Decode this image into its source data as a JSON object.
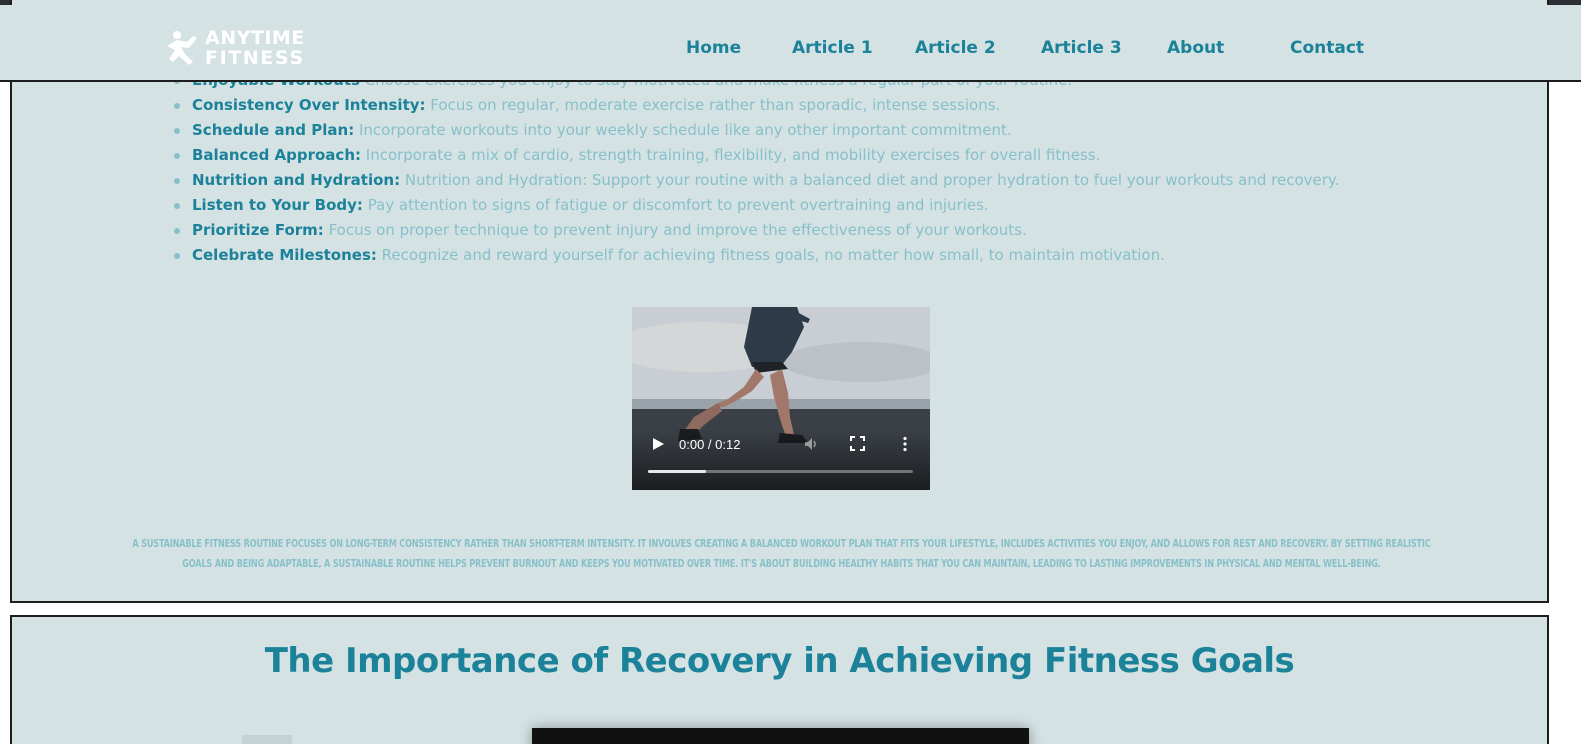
{
  "header": {
    "logo_line1": "ANYTIME",
    "logo_line2": "FITNESS",
    "nav": [
      {
        "label": "Home"
      },
      {
        "label": "Article 1"
      },
      {
        "label": "Article 2"
      },
      {
        "label": "Article 3"
      },
      {
        "label": "About"
      },
      {
        "label": "Contact"
      }
    ]
  },
  "article": {
    "tips": [
      {
        "title": "Enjoyable Workouts",
        "text": " Choose exercises you enjoy to stay motivated and make fitness a regular part of your routine."
      },
      {
        "title": "Consistency Over Intensity:",
        "text": " Focus on regular, moderate exercise rather than sporadic, intense sessions."
      },
      {
        "title": "Schedule and Plan:",
        "text": " Incorporate workouts into your weekly schedule like any other important commitment."
      },
      {
        "title": "Balanced Approach:",
        "text": " Incorporate a mix of cardio, strength training, flexibility, and mobility exercises for overall fitness."
      },
      {
        "title": "Nutrition and Hydration:",
        "text": " Nutrition and Hydration: Support your routine with a balanced diet and proper hydration to fuel your workouts and recovery."
      },
      {
        "title": "Listen to Your Body:",
        "text": " Pay attention to signs of fatigue or discomfort to prevent overtraining and injuries."
      },
      {
        "title": "Prioritize Form:",
        "text": " Focus on proper technique to prevent injury and improve the effectiveness of your workouts."
      },
      {
        "title": "Celebrate Milestones:",
        "text": " Recognize and reward yourself for achieving fitness goals, no matter how small, to maintain motivation."
      }
    ],
    "video": {
      "time": "0:00 / 0:12",
      "progress": 0.22
    },
    "summary": "A sustainable fitness routine focuses on long-term consistency rather than short-term intensity. It involves creating a balanced workout plan that fits your lifestyle, includes activities you enjoy, and allows for rest and recovery. By setting realistic goals and being adaptable, a sustainable routine helps prevent burnout and keeps you motivated over time. It's about building healthy habits that you can maintain, leading to lasting improvements in physical and mental well-being."
  },
  "next_section": {
    "title": "The Importance of Recovery in Achieving Fitness Goals"
  },
  "colors": {
    "panel_bg": "#d4e2e4",
    "accent": "#1b8299",
    "muted_text": "#88c0c9",
    "border": "#1d1d1d"
  },
  "icons": [
    "runner-logo-icon",
    "play-icon",
    "volume-icon",
    "fullscreen-icon",
    "more-options-icon"
  ]
}
